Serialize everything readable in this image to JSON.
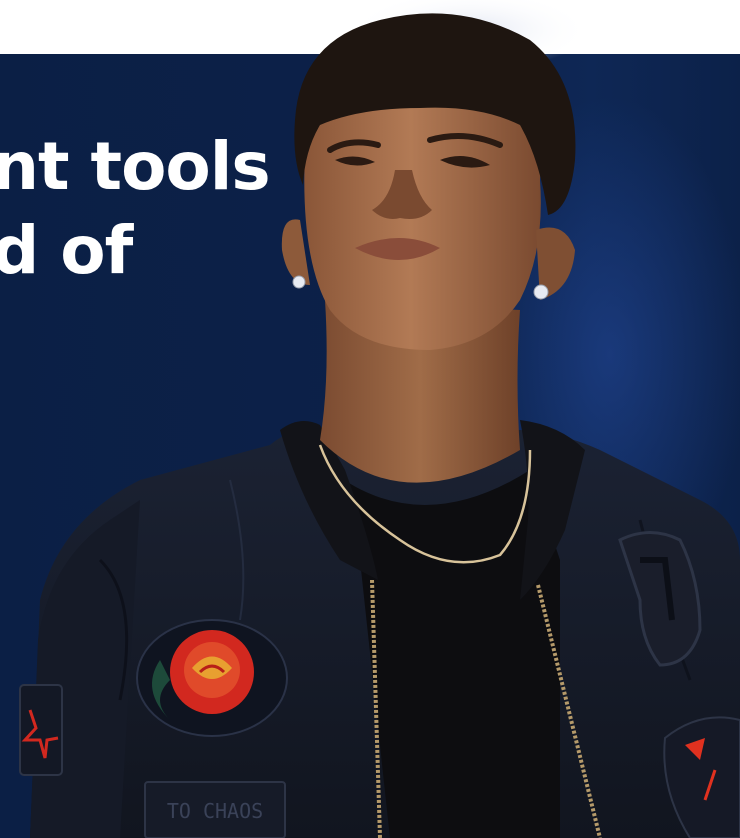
{
  "hero": {
    "headline_line1": "nt tools",
    "headline_line2": "d of"
  },
  "photo": {
    "patch_text": "TO CHAOS",
    "alt": "young man in black bomber jacket with rose patch looking upward"
  },
  "colors": {
    "panel": "#0c2149",
    "page": "#ffffff",
    "headline": "#ffffff"
  }
}
